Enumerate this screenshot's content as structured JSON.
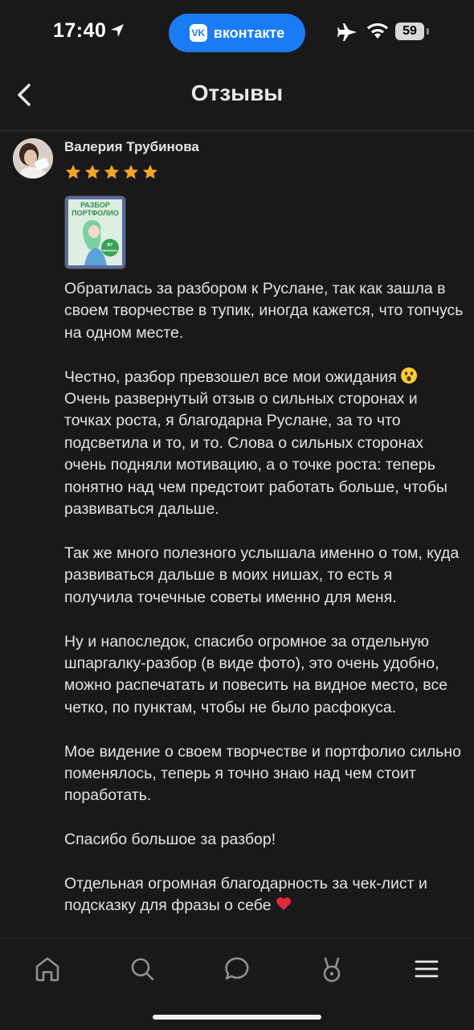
{
  "status_bar": {
    "time": "17:40",
    "vk_label": "вконтакте",
    "vk_logo": "VK",
    "battery": "59",
    "icons": [
      "location-arrow-icon",
      "airplane-icon",
      "wifi-icon",
      "battery-icon"
    ]
  },
  "header": {
    "title": "Отзывы",
    "back_icon": "chevron-left-icon"
  },
  "review": {
    "author": "Валерия Трубинова",
    "rating": 5,
    "attachment": {
      "title_line1": "РАЗБОР",
      "title_line2": "ПОРТФОЛИО",
      "badge_line1": "BY",
      "badge_line2": "MEISSHA"
    },
    "paragraphs": [
      "Обратилась за разбором к Руслане, так как зашла в своем творчестве в тупик, иногда кажется, что топчусь на одном месте.",
      "Честно, разбор превзошел все мои ожидания",
      "Очень развернутый отзыв о сильных сторонах и точках роста, я благодарна Руслане, за то что подсветила и то, и то. Слова о сильных сторонах очень подняли мотивацию, а о точке роста: теперь понятно над чем предстоит работать больше, чтобы развиваться дальше.",
      "Так же много полезного услышала именно о том, куда развиваться дальше в моих нишах, то есть я получила точечные советы именно для меня.",
      "Ну и напоследок, спасибо огромное за отдельную шпаргалку-разбор (в виде фото), это очень удобно, можно распечатать и повесить на видное место, все четко, по пунктам, чтобы не было расфокуса.",
      "Мое видение о своем творчестве и портфолио сильно поменялось, теперь я точно знаю над чем стоит поработать.",
      "Спасибо большое за разбор!",
      "Отдельная огромная благодарность за чек-лист и подсказку для фразы о себе"
    ]
  },
  "tab_bar": {
    "tabs": [
      {
        "icon": "home-icon"
      },
      {
        "icon": "search-icon"
      },
      {
        "icon": "messages-icon"
      },
      {
        "icon": "clips-icon"
      },
      {
        "icon": "menu-icon"
      }
    ]
  },
  "colors": {
    "background": "#19191a",
    "text": "#e1e3e6",
    "accent": "#1a7cf5",
    "star": "#f5a623",
    "heart": "#e0283e"
  }
}
